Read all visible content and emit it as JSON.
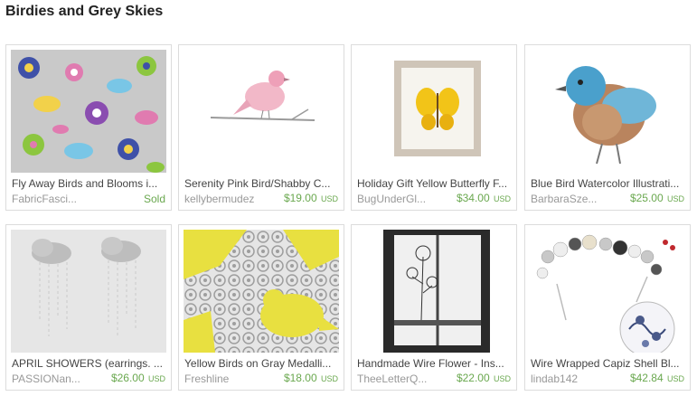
{
  "page": {
    "title": "Birdies and Grey Skies"
  },
  "items": [
    {
      "title": "Fly Away Birds and Blooms i...",
      "shop": "FabricFasci...",
      "price": "",
      "currency": "",
      "status": "Sold",
      "image_icon": "birds-blooms-fabric-image"
    },
    {
      "title": "Serenity Pink Bird/Shabby C...",
      "shop": "kellybermudez",
      "price": "$19.00",
      "currency": "USD",
      "status": "",
      "image_icon": "pink-bird-image"
    },
    {
      "title": "Holiday Gift Yellow Butterfly F...",
      "shop": "BugUnderGl...",
      "price": "$34.00",
      "currency": "USD",
      "status": "",
      "image_icon": "butterfly-frame-image"
    },
    {
      "title": "Blue Bird Watercolor Illustrati...",
      "shop": "BarbaraSze...",
      "price": "$25.00",
      "currency": "USD",
      "status": "",
      "image_icon": "blue-bird-image"
    },
    {
      "title": "APRIL SHOWERS (earrings. ...",
      "shop": "PASSIONan...",
      "price": "$26.00",
      "currency": "USD",
      "status": "",
      "image_icon": "cloud-earrings-image"
    },
    {
      "title": "Yellow Birds on Gray Medalli...",
      "shop": "Freshline",
      "price": "$18.00",
      "currency": "USD",
      "status": "",
      "image_icon": "yellow-birds-pattern-image"
    },
    {
      "title": "Handmade Wire Flower - Ins...",
      "shop": "TheeLetterQ...",
      "price": "$22.00",
      "currency": "USD",
      "status": "",
      "image_icon": "wire-flower-image"
    },
    {
      "title": "Wire Wrapped Capiz Shell Bl...",
      "shop": "lindab142",
      "price": "$42.84",
      "currency": "USD",
      "status": "",
      "image_icon": "shell-necklace-image"
    }
  ],
  "colors": {
    "price": "#6aa84f",
    "shop": "#999999",
    "border": "#dcdcdc"
  }
}
